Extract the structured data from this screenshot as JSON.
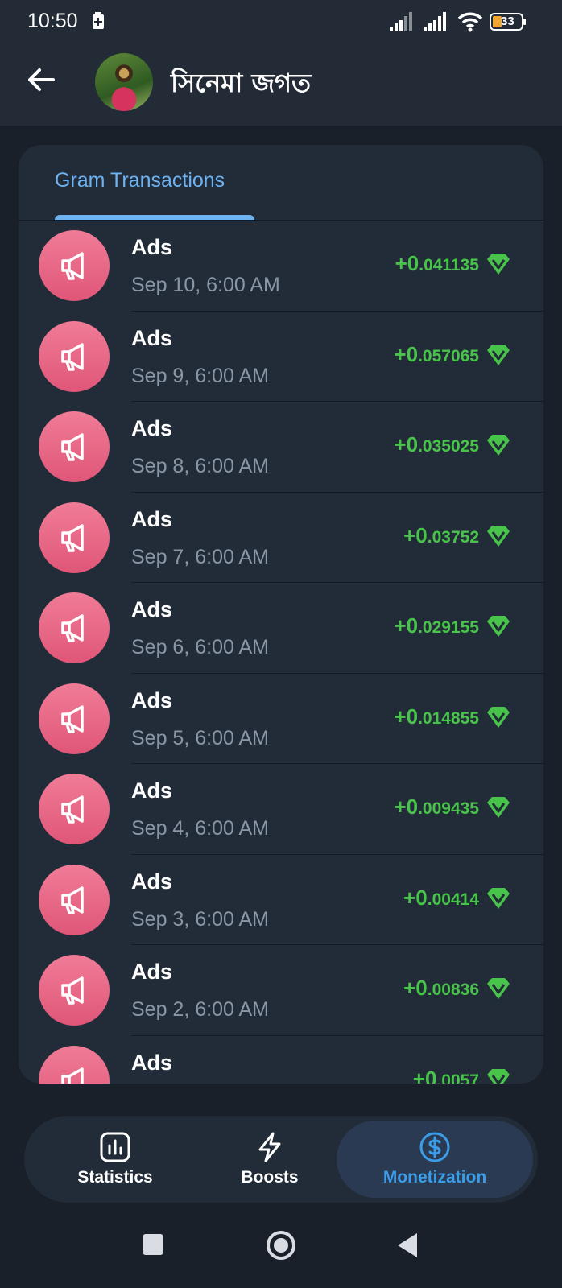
{
  "status_bar": {
    "time": "10:50",
    "battery_level": "33"
  },
  "header": {
    "channel_name": "সিনেমা জগত"
  },
  "tabs": [
    {
      "label": "Gram Transactions",
      "active": true
    }
  ],
  "transactions": [
    {
      "title": "Ads",
      "date": "Sep 10, 6:00 AM",
      "amount_int": "+0",
      "amount_frac": ".041135"
    },
    {
      "title": "Ads",
      "date": "Sep 9, 6:00 AM",
      "amount_int": "+0",
      "amount_frac": ".057065"
    },
    {
      "title": "Ads",
      "date": "Sep 8, 6:00 AM",
      "amount_int": "+0",
      "amount_frac": ".035025"
    },
    {
      "title": "Ads",
      "date": "Sep 7, 6:00 AM",
      "amount_int": "+0",
      "amount_frac": ".03752"
    },
    {
      "title": "Ads",
      "date": "Sep 6, 6:00 AM",
      "amount_int": "+0",
      "amount_frac": ".029155"
    },
    {
      "title": "Ads",
      "date": "Sep 5, 6:00 AM",
      "amount_int": "+0",
      "amount_frac": ".014855"
    },
    {
      "title": "Ads",
      "date": "Sep 4, 6:00 AM",
      "amount_int": "+0",
      "amount_frac": ".009435"
    },
    {
      "title": "Ads",
      "date": "Sep 3, 6:00 AM",
      "amount_int": "+0",
      "amount_frac": ".00414"
    },
    {
      "title": "Ads",
      "date": "Sep 2, 6:00 AM",
      "amount_int": "+0",
      "amount_frac": ".00836"
    },
    {
      "title": "Ads",
      "date": "",
      "amount_int": "+0",
      "amount_frac": ".0057"
    }
  ],
  "bottom_nav": [
    {
      "label": "Statistics",
      "icon": "chart-icon",
      "active": false
    },
    {
      "label": "Boosts",
      "icon": "lightning-icon",
      "active": false
    },
    {
      "label": "Monetization",
      "icon": "dollar-icon",
      "active": true
    }
  ],
  "colors": {
    "background": "#1a2029",
    "card": "#222b38",
    "accent": "#6db3f2",
    "positive_amount": "#49c44a",
    "ads_avatar": "#e96686",
    "active_nav": "#3b9de8"
  }
}
